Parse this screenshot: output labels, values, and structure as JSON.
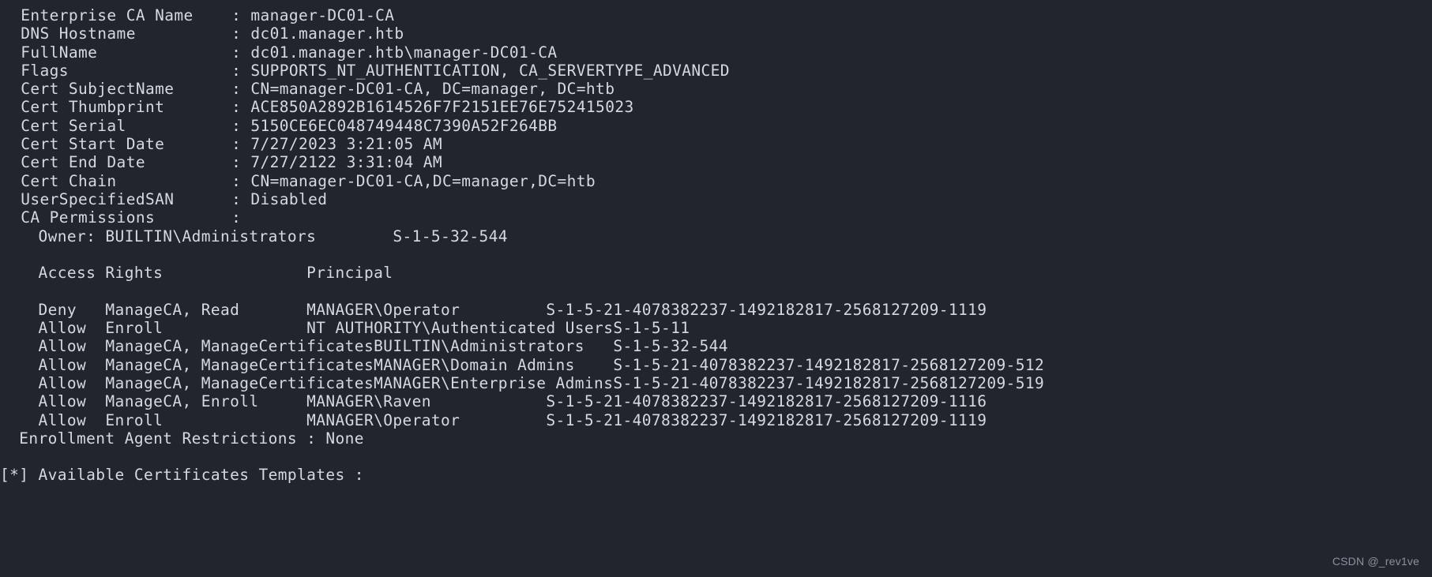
{
  "terminal": {
    "background_color": "#22242e",
    "foreground_color": "#d6d9e0",
    "ca_info": {
      "rows": [
        {
          "label": "  Enterprise CA Name",
          "sep": ": ",
          "value": "manager-DC01-CA"
        },
        {
          "label": "  DNS Hostname",
          "sep": ": ",
          "value": "dc01.manager.htb"
        },
        {
          "label": "  FullName",
          "sep": ": ",
          "value": "dc01.manager.htb\\manager-DC01-CA"
        },
        {
          "label": "  Flags",
          "sep": ": ",
          "value": "SUPPORTS_NT_AUTHENTICATION, CA_SERVERTYPE_ADVANCED"
        },
        {
          "label": "  Cert SubjectName",
          "sep": ": ",
          "value": "CN=manager-DC01-CA, DC=manager, DC=htb"
        },
        {
          "label": "  Cert Thumbprint",
          "sep": ": ",
          "value": "ACE850A2892B1614526F7F2151EE76E752415023"
        },
        {
          "label": "  Cert Serial",
          "sep": ": ",
          "value": "5150CE6EC048749448C7390A52F264BB"
        },
        {
          "label": "  Cert Start Date",
          "sep": ": ",
          "value": "7/27/2023 3:21:05 AM"
        },
        {
          "label": "  Cert End Date",
          "sep": ": ",
          "value": "7/27/2122 3:31:04 AM"
        },
        {
          "label": "  Cert Chain",
          "sep": ": ",
          "value": "CN=manager-DC01-CA,DC=manager,DC=htb"
        },
        {
          "label": "  UserSpecifiedSAN",
          "sep": ": ",
          "value": "Disabled"
        },
        {
          "label": "  CA Permissions",
          "sep": ": ",
          "value": ""
        }
      ],
      "label_width": 24,
      "owner_line": "    Owner: BUILTIN\\Administrators        S-1-5-32-544"
    },
    "permissions_table": {
      "header": {
        "access_rights": "Access Rights",
        "principal": "Principal"
      },
      "rows": [
        {
          "effect": "Deny",
          "rights": "ManageCA, Read",
          "principal": "MANAGER\\Operator",
          "sid": "S-1-5-21-4078382237-1492182817-2568127209-1119"
        },
        {
          "effect": "Allow",
          "rights": "Enroll",
          "principal": "NT AUTHORITY\\Authenticated Users",
          "sid": "S-1-5-11"
        },
        {
          "effect": "Allow",
          "rights": "ManageCA, ManageCertificates",
          "principal": "BUILTIN\\Administrators",
          "sid": "S-1-5-32-544"
        },
        {
          "effect": "Allow",
          "rights": "ManageCA, ManageCertificates",
          "principal": "MANAGER\\Domain Admins",
          "sid": "S-1-5-21-4078382237-1492182817-2568127209-512"
        },
        {
          "effect": "Allow",
          "rights": "ManageCA, ManageCertificates",
          "principal": "MANAGER\\Enterprise Admins",
          "sid": "S-1-5-21-4078382237-1492182817-2568127209-519"
        },
        {
          "effect": "Allow",
          "rights": "ManageCA, Enroll",
          "principal": "MANAGER\\Raven",
          "sid": "S-1-5-21-4078382237-1492182817-2568127209-1116"
        },
        {
          "effect": "Allow",
          "rights": "Enroll",
          "principal": "MANAGER\\Operator",
          "sid": "S-1-5-21-4078382237-1492182817-2568127209-1119"
        }
      ]
    },
    "enrollment_agent_restrictions": {
      "label": "  Enrollment Agent Restrictions",
      "sep": " : ",
      "value": "None"
    },
    "available_templates_line": "[*] Available Certificates Templates :"
  },
  "watermark": {
    "text": "CSDN @_rev1ve"
  }
}
